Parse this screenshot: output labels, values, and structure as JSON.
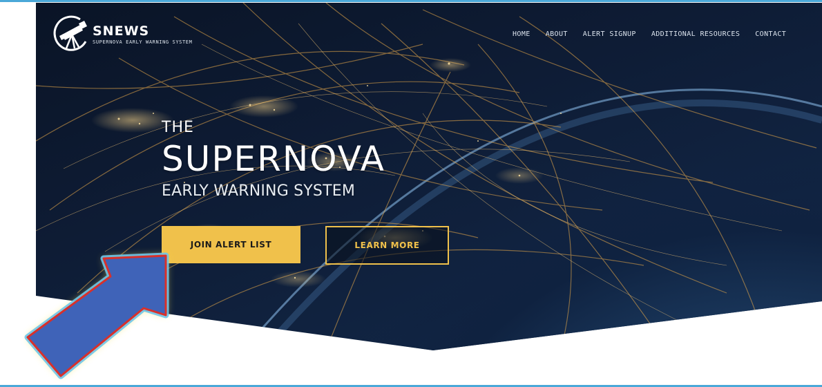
{
  "brand": {
    "name": "SNEWS",
    "tagline": "SUPERNOVA EARLY WARNING SYSTEM",
    "logo_icon": "telescope-icon"
  },
  "nav": {
    "items": [
      {
        "label": "HOME"
      },
      {
        "label": "ABOUT"
      },
      {
        "label": "ALERT SIGNUP"
      },
      {
        "label": "ADDITIONAL RESOURCES"
      },
      {
        "label": "CONTACT"
      }
    ]
  },
  "hero": {
    "kicker": "THE",
    "title": "SUPERNOVA",
    "subtitle": "EARLY WARNING SYSTEM",
    "primary_button": "JOIN ALERT LIST",
    "secondary_button": "LEARN MORE"
  },
  "annotation": {
    "icon": "pointer-arrow-icon"
  },
  "colors": {
    "accent": "#f0c14b",
    "frame": "#4aa8d8",
    "arrow_fill": "#3f63b8",
    "arrow_outline": "#d9302a",
    "arrow_glow": "#f3e35a"
  }
}
